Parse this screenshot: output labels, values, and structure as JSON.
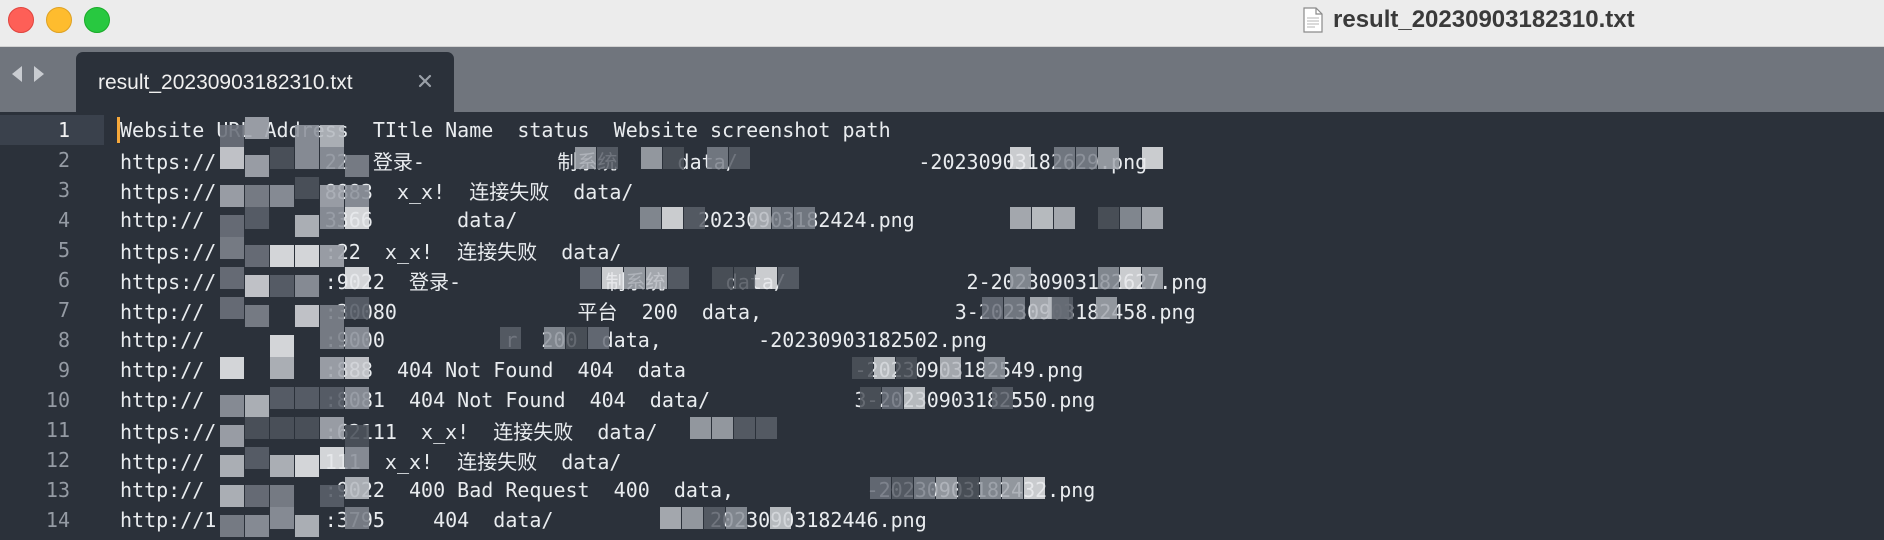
{
  "window": {
    "title": "result_20230903182310.txt",
    "title_icon": "document-icon"
  },
  "tabs": [
    {
      "label": "result_20230903182310.txt",
      "active": true
    }
  ],
  "editor": {
    "current_line": 1,
    "lines": [
      {
        "num": "1",
        "text": "Website URL Address  TItle Name  status  Website screenshot path"
      },
      {
        "num": "2",
        "text": "https://         22  登录-           制系统     data/               -20230903182629.png"
      },
      {
        "num": "3",
        "text": "https://         8883  x_x!  连接失败  data/"
      },
      {
        "num": "4",
        "text": "http://          3366       data/               20230903182424.png"
      },
      {
        "num": "5",
        "text": "https://         :22  x_x!  连接失败  data/"
      },
      {
        "num": "6",
        "text": "https://         :9022  登录-            制系统     data/               2-20230903182627.png"
      },
      {
        "num": "7",
        "text": "http://          :30080               平台  200  data,                3-20230903182458.png"
      },
      {
        "num": "8",
        "text": "http://          :9000          r  200  data,        -20230903182502.png"
      },
      {
        "num": "9",
        "text": "http://          :888  404 Not Found  404  data              -20230903182549.png"
      },
      {
        "num": "10",
        "text": "http://          :8081  404 Not Found  404  data/            3-20230903182550.png"
      },
      {
        "num": "11",
        "text": "https://         :62111  x_x!  连接失败  data/"
      },
      {
        "num": "12",
        "text": "http://          111  x_x!  连接失败  data/"
      },
      {
        "num": "13",
        "text": "http://          :9022  400 Bad Request  400  data,           -20230903182432.png"
      },
      {
        "num": "14",
        "text": "http://1         :3795    404  data/             20230903182446.png"
      }
    ]
  },
  "colors": {
    "background": "#2b313a",
    "tabbar": "#70757d",
    "caret": "#f6a83b",
    "text": "#e9ecef",
    "gutter_text": "#959ba4"
  }
}
